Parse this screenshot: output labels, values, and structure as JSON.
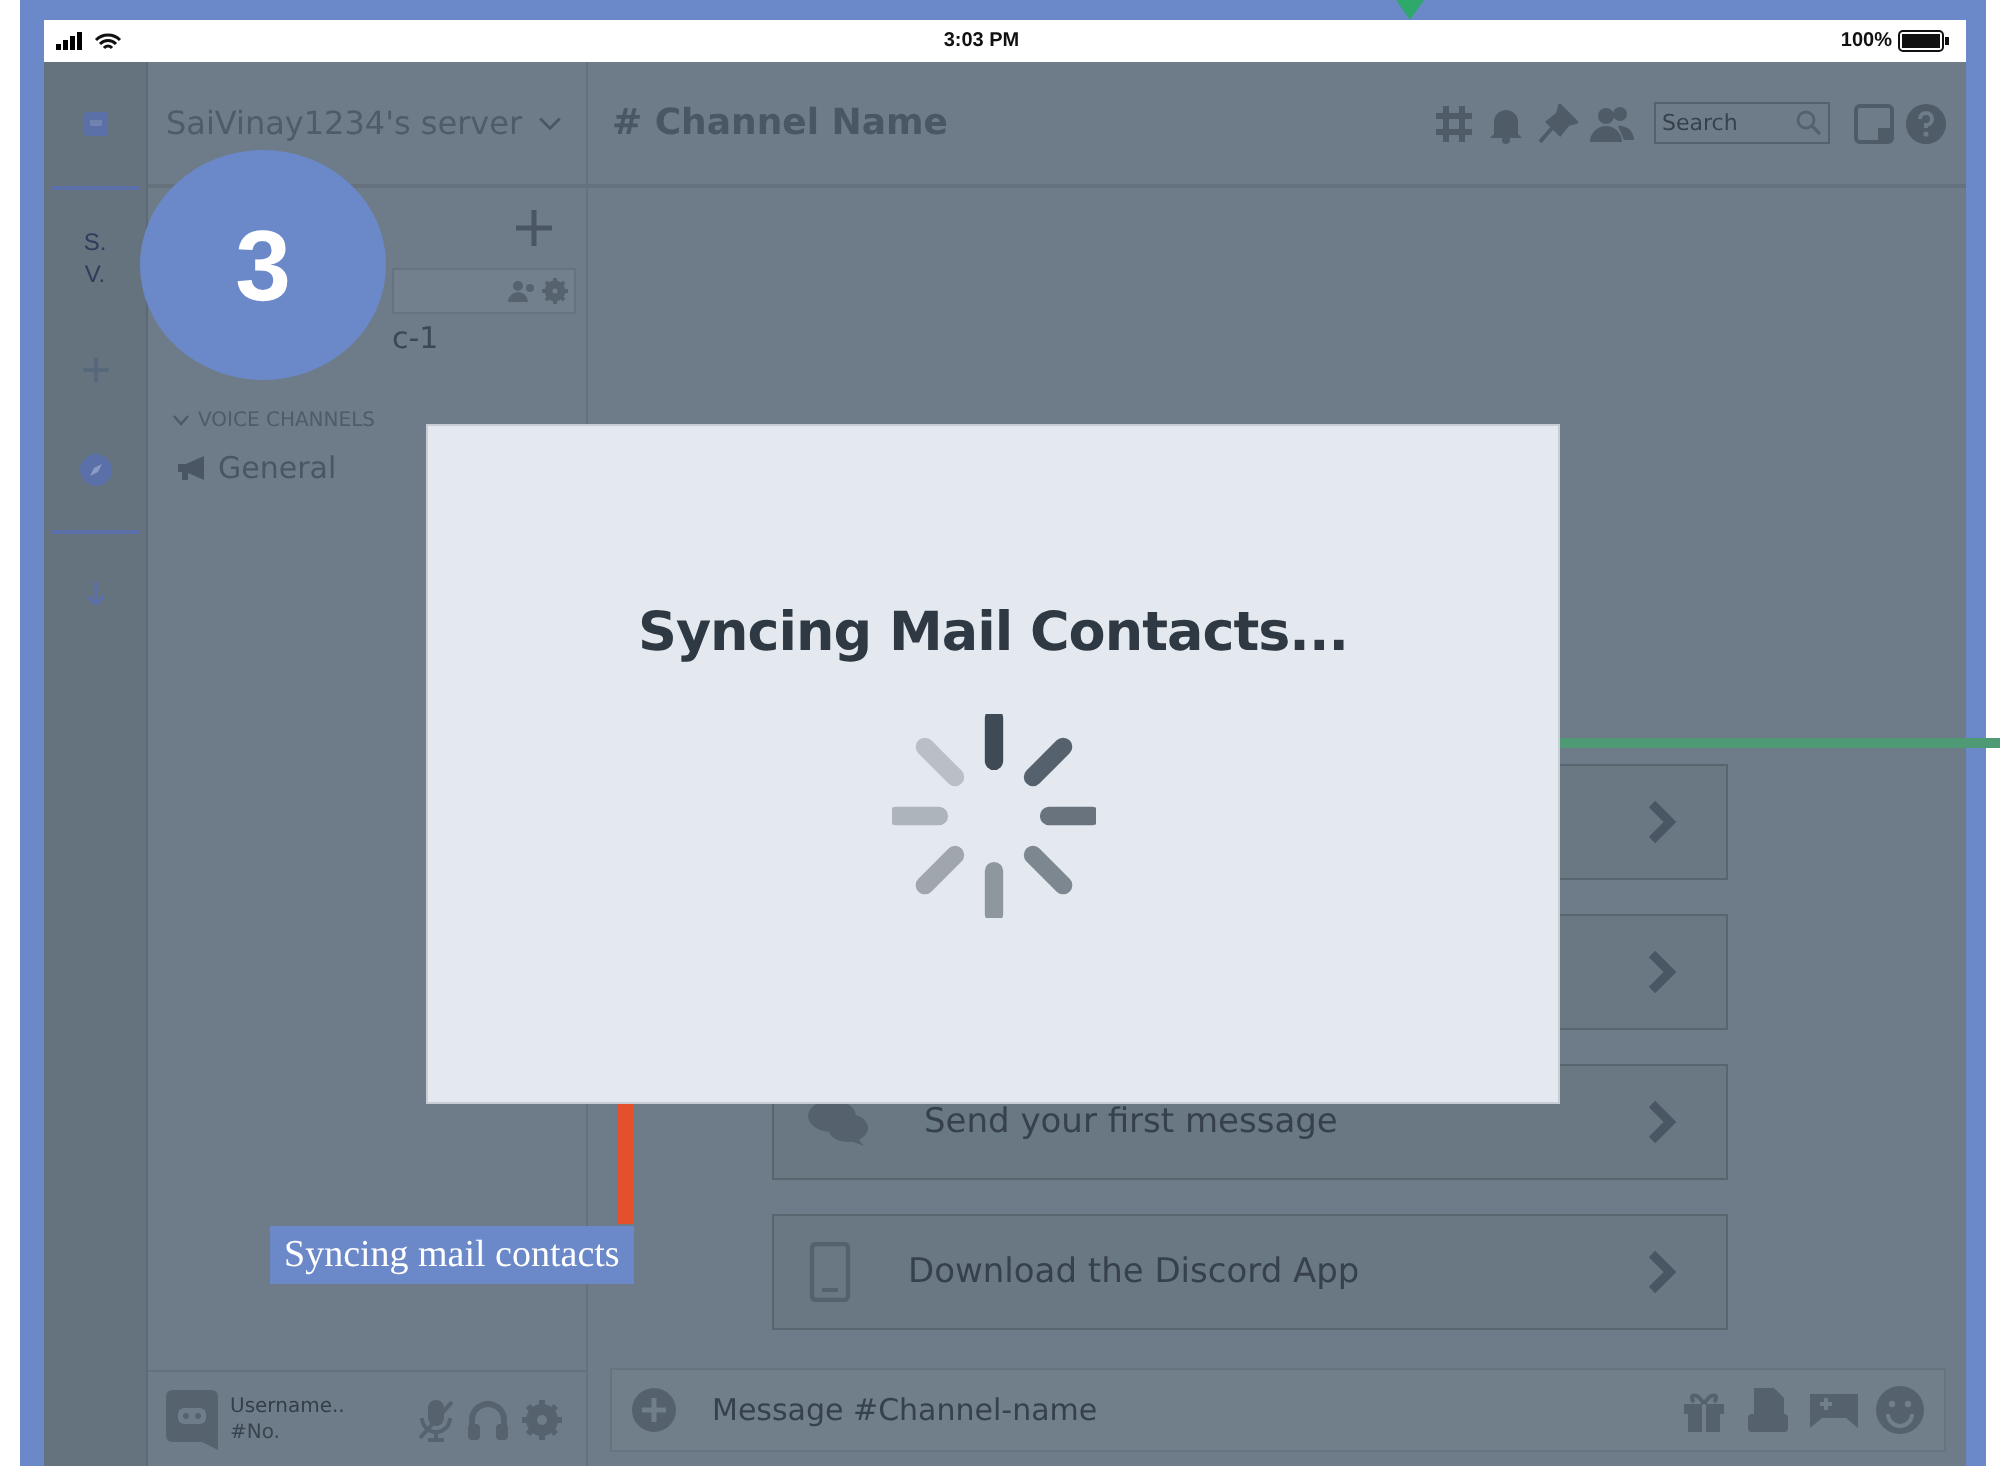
{
  "status_bar": {
    "time": "3:03 PM",
    "battery": "100%"
  },
  "server_rail": {
    "server_initials": "S. V."
  },
  "channel_sidebar": {
    "server_name": "SaiVinay1234's server",
    "text_channels": [
      {
        "name": "c-1"
      }
    ],
    "voice_heading": "VOICE CHANNELS",
    "voice_channels": [
      {
        "name": "General"
      }
    ],
    "user": {
      "name": "Username..",
      "tag": "#No."
    }
  },
  "header": {
    "channel_name": "# Channel Name",
    "search_placeholder": "Search"
  },
  "cards": [
    {
      "kind": "covered"
    },
    {
      "kind": "covered"
    },
    {
      "kind": "message",
      "label": "Send your first message"
    },
    {
      "kind": "download",
      "label": "Download the Discord App"
    }
  ],
  "composer": {
    "placeholder": "Message #Channel-name"
  },
  "dialog": {
    "title": "Syncing Mail Contacts..."
  },
  "annotations": {
    "step": "3",
    "caption": "Syncing mail contacts"
  }
}
